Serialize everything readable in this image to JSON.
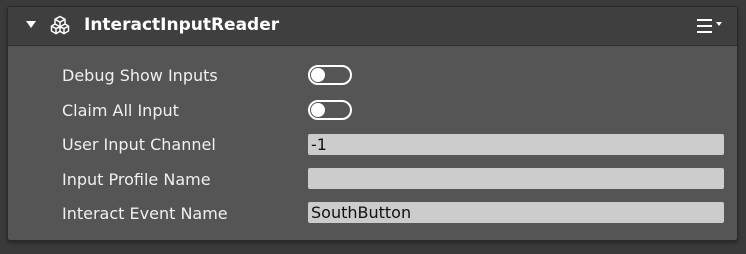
{
  "component": {
    "title": "InteractInputReader",
    "icon": "cube-outline-icon",
    "menu_icon": "hamburger-menu-icon"
  },
  "properties": [
    {
      "label": "Debug Show Inputs",
      "type": "toggle",
      "value": false
    },
    {
      "label": "Claim All Input",
      "type": "toggle",
      "value": false
    },
    {
      "label": "User Input Channel",
      "type": "text",
      "value": "-1"
    },
    {
      "label": "Input Profile Name",
      "type": "text",
      "value": ""
    },
    {
      "label": "Interact Event Name",
      "type": "text",
      "value": "SouthButton"
    }
  ],
  "colors": {
    "panel_bg": "#555555",
    "header_bg": "#3f3f3f",
    "field_bg": "#cccccc",
    "text": "#f0f0f0"
  }
}
